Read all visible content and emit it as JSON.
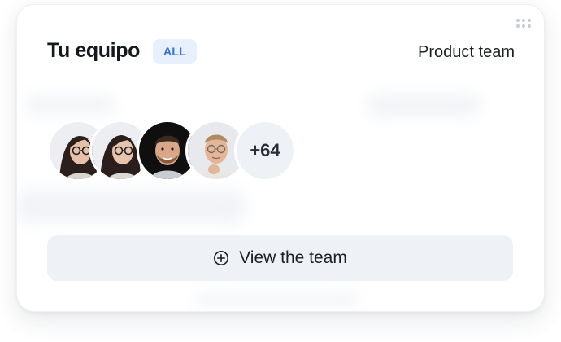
{
  "card": {
    "title": "Tu equipo",
    "badge": "ALL",
    "team_name": "Product team"
  },
  "members": {
    "avatars": [
      {
        "name": "member-1-avatar",
        "description": "woman with glasses, light background"
      },
      {
        "name": "member-2-avatar",
        "description": "woman with glasses, light background"
      },
      {
        "name": "member-3-avatar",
        "description": "bearded man, dark background"
      },
      {
        "name": "member-4-avatar",
        "description": "man with glasses, light background"
      }
    ],
    "more_count": "+64"
  },
  "actions": {
    "view_team_label": "View the team",
    "view_team_icon": "plus-circle-icon"
  },
  "colors": {
    "badge_bg": "#e8f0fe",
    "badge_text": "#2f6fe0",
    "button_bg": "#eef2f7"
  }
}
